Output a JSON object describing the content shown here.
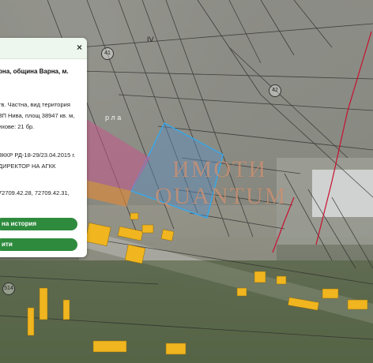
{
  "watermark": {
    "line1": "ИМОТИ",
    "line2": "QUANTUM"
  },
  "map": {
    "parcel_labels": [
      "IV",
      "41",
      "42",
      "514",
      "р л а"
    ]
  },
  "info_panel": {
    "close_icon": "×",
    "title": "рна, община Варна, м.",
    "lines": [
      "тв. Частна, вид територия",
      "ЗП Нива, площ 38947 кв. м,",
      "ихове: 21 бр.",
      "ЗККР РД-18-29/23.04.2015 г.",
      "ДИРЕКТОР НА АГКК",
      "72709.42.28,    72709.42.31,"
    ],
    "buttons": {
      "history": "на история",
      "second": "ити"
    }
  },
  "colors": {
    "highlight_parcel": "#3aa7e6",
    "boundary": "#c8102e",
    "button": "#2e8b3e"
  }
}
